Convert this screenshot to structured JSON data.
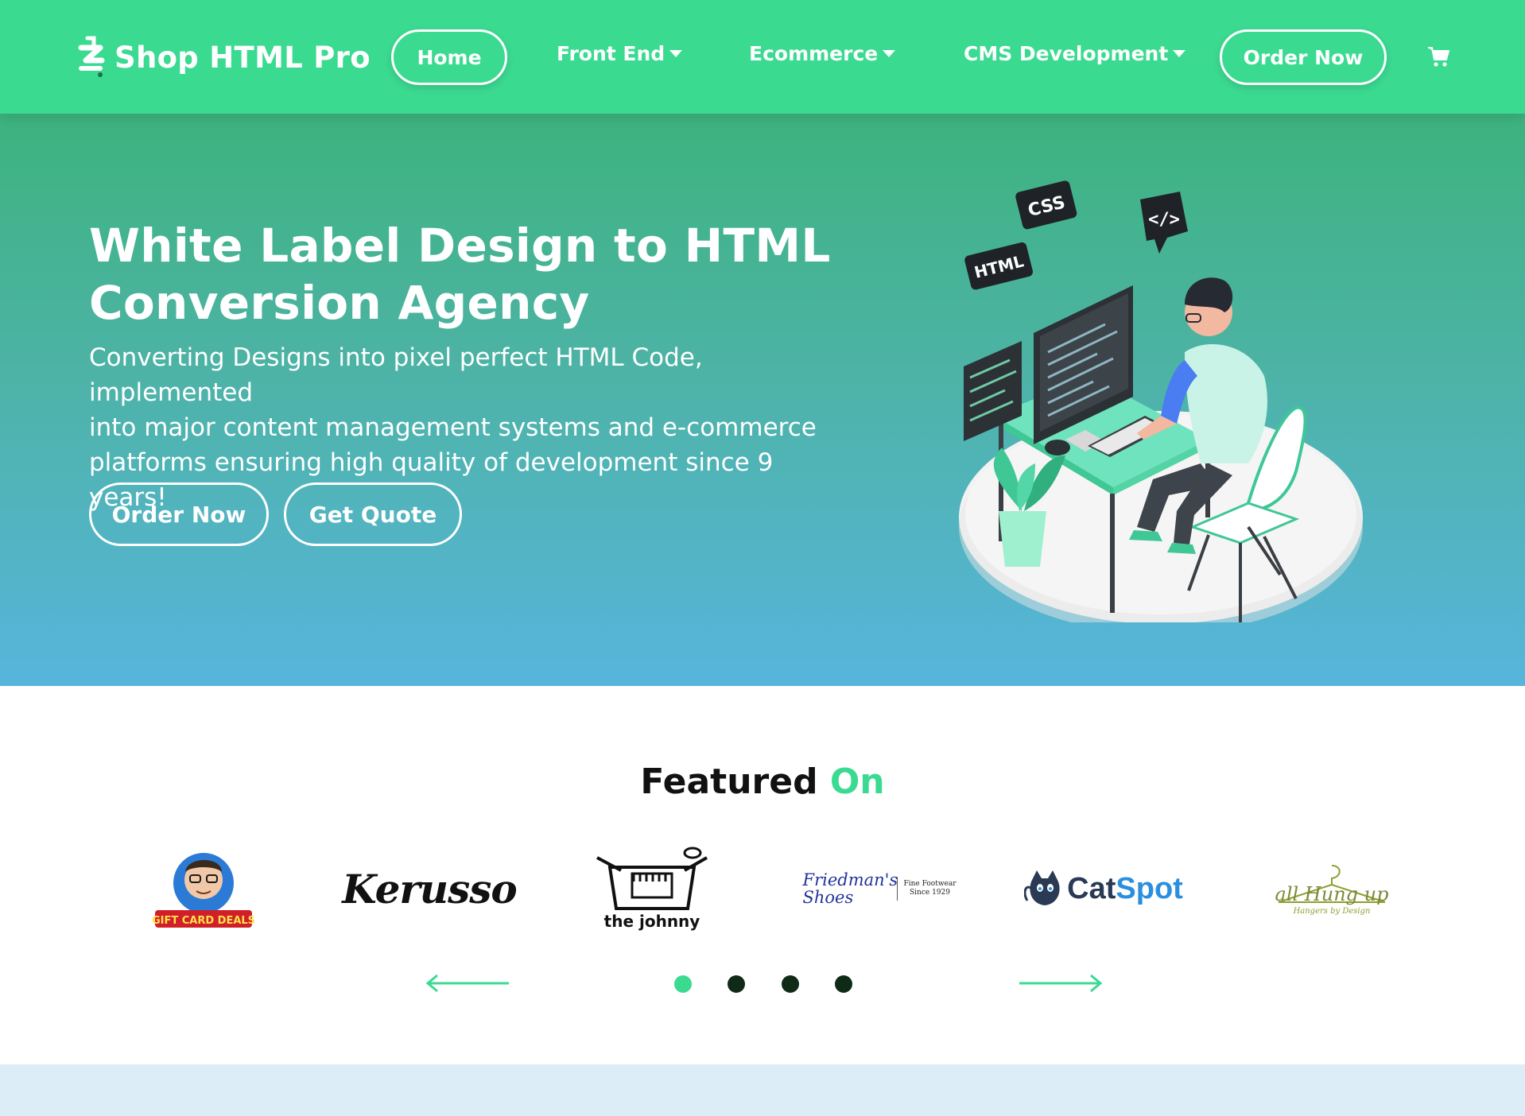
{
  "brand": {
    "name": "Shop HTML Pro"
  },
  "nav": {
    "home": "Home",
    "front_end": "Front End",
    "ecommerce": "Ecommerce",
    "cms": "CMS Development",
    "order": "Order Now",
    "cart_icon": "shopping-cart-icon"
  },
  "hero": {
    "title_line1": "White Label Design to HTML",
    "title_line2": "Conversion Agency",
    "subtitle_line1": "Converting Designs into pixel perfect HTML Code, implemented",
    "subtitle_line2": "into major content management systems and e-commerce",
    "subtitle_line3": "platforms ensuring high quality of development since 9 years!",
    "order_button": "Order Now",
    "quote_button": "Get Quote",
    "illustration_tags": {
      "css": "CSS",
      "html": "HTML",
      "code": "</>"
    }
  },
  "featured": {
    "title_part1": "Featured",
    "title_part2": "On",
    "logos": [
      {
        "name": "giftcard-deals-logo",
        "text": "GIFT CARD DEALS"
      },
      {
        "name": "kerusso-logo",
        "text": "Kerusso"
      },
      {
        "name": "the-johnny-logo",
        "text": "the johnny"
      },
      {
        "name": "friedmans-shoes-logo",
        "text": "Friedman's Shoes",
        "tagline": "Fine Footwear Since 1929"
      },
      {
        "name": "catspot-logo",
        "text_a": "Cat",
        "text_b": "Spot"
      },
      {
        "name": "all-hung-up-logo",
        "text": "all Hung up",
        "tagline": "Hangers by Design"
      }
    ],
    "carousel": {
      "pages": 4,
      "active_page": 1
    }
  },
  "colors": {
    "accent": "#3bda91",
    "hero_top": "#3db37e",
    "hero_bottom": "#57b5dc",
    "dot": "#0f2a17",
    "footer_band": "#dcedf8"
  }
}
